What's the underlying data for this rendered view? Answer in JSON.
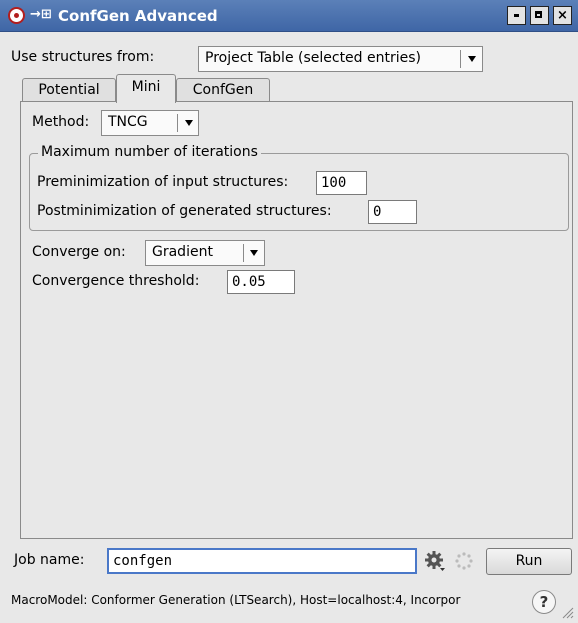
{
  "window": {
    "title": "ConfGen Advanced",
    "pin_glyph": "→⊞",
    "close_glyph": "×"
  },
  "source": {
    "label": "Use structures from:",
    "value": "Project Table (selected entries)"
  },
  "tabs": [
    {
      "label": "Potential",
      "selected": false
    },
    {
      "label": "Mini",
      "selected": true
    },
    {
      "label": "ConfGen",
      "selected": false
    }
  ],
  "mini": {
    "method_label": "Method:",
    "method_value": "TNCG",
    "iterations_title": "Maximum number of iterations",
    "premin_label": "Preminimization of input structures:",
    "premin_value": "100",
    "postmin_label": "Postminimization of generated structures:",
    "postmin_value": "0",
    "converge_label": "Converge on:",
    "converge_value": "Gradient",
    "threshold_label": "Convergence threshold:",
    "threshold_value": "0.05"
  },
  "job": {
    "label": "Job name:",
    "value": "confgen",
    "run_label": "Run"
  },
  "status": {
    "text": "MacroModel: Conformer Generation (LTSearch), Host=localhost:4, Incorpor",
    "help_glyph": "?"
  },
  "colors": {
    "titlebar": "#4a70ae",
    "background": "#e8e8e8",
    "focus_border": "#4a78c8"
  }
}
